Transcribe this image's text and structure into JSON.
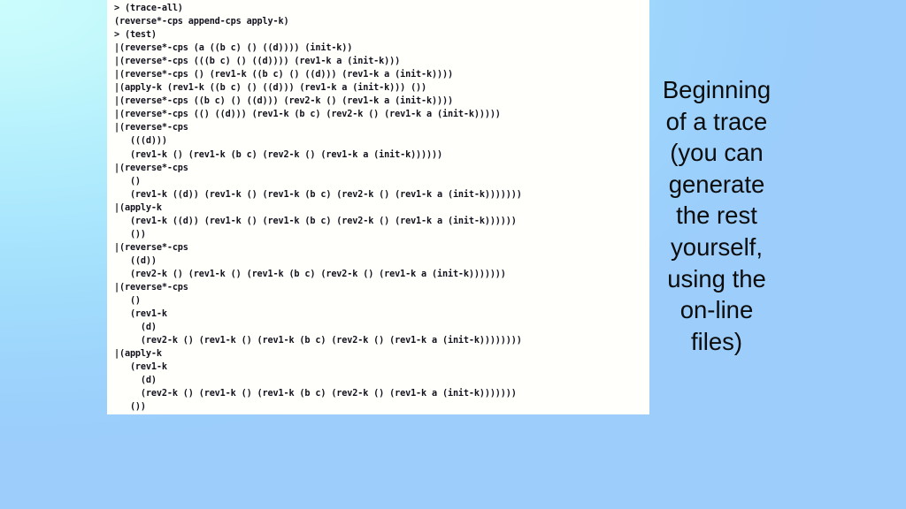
{
  "slide": {
    "background": {
      "gradient_from": "#ccfdfd",
      "gradient_to": "#9ccdfb"
    }
  },
  "code_panel": {
    "background": "#fffffb",
    "text_color": "#12121e",
    "lines": [
      "> (trace-all)",
      "(reverse*-cps append-cps apply-k)",
      "> (test)",
      "|(reverse*-cps (a ((b c) () ((d)))) (init-k))",
      "|(reverse*-cps (((b c) () ((d)))) (rev1-k a (init-k)))",
      "|(reverse*-cps () (rev1-k ((b c) () ((d))) (rev1-k a (init-k))))",
      "|(apply-k (rev1-k ((b c) () ((d))) (rev1-k a (init-k))) ())",
      "|(reverse*-cps ((b c) () ((d))) (rev2-k () (rev1-k a (init-k))))",
      "|(reverse*-cps (() ((d))) (rev1-k (b c) (rev2-k () (rev1-k a (init-k)))))",
      "|(reverse*-cps",
      "   (((d)))",
      "   (rev1-k () (rev1-k (b c) (rev2-k () (rev1-k a (init-k))))))",
      "|(reverse*-cps",
      "   ()",
      "   (rev1-k ((d)) (rev1-k () (rev1-k (b c) (rev2-k () (rev1-k a (init-k)))))))",
      "|(apply-k",
      "   (rev1-k ((d)) (rev1-k () (rev1-k (b c) (rev2-k () (rev1-k a (init-k))))))",
      "   ())",
      "|(reverse*-cps",
      "   ((d))",
      "   (rev2-k () (rev1-k () (rev1-k (b c) (rev2-k () (rev1-k a (init-k)))))))",
      "|(reverse*-cps",
      "   ()",
      "   (rev1-k",
      "     (d)",
      "     (rev2-k () (rev1-k () (rev1-k (b c) (rev2-k () (rev1-k a (init-k))))))))",
      "|(apply-k",
      "   (rev1-k",
      "     (d)",
      "     (rev2-k () (rev1-k () (rev1-k (b c) (rev2-k () (rev1-k a (init-k)))))))",
      "   ())"
    ]
  },
  "caption": {
    "text": "Beginning\nof a trace\n(you can\ngenerate\nthe rest\nyourself,\nusing the\non-line\nfiles)"
  }
}
